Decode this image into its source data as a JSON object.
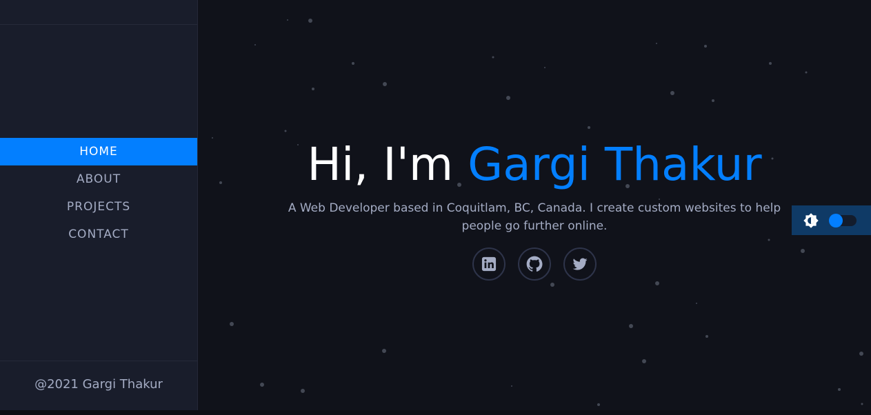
{
  "sidebar": {
    "nav": [
      {
        "label": "HOME",
        "active": true
      },
      {
        "label": "ABOUT",
        "active": false
      },
      {
        "label": "PROJECTS",
        "active": false
      },
      {
        "label": "CONTACT",
        "active": false
      }
    ],
    "footer": "@2021 Gargi Thakur"
  },
  "hero": {
    "greeting": "Hi, I'm ",
    "name": "Gargi Thakur",
    "tagline": "A Web Developer based in Coquitlam, BC, Canada. I create custom websites to help people go further online."
  },
  "socials": [
    {
      "icon": "linkedin-icon"
    },
    {
      "icon": "github-icon"
    },
    {
      "icon": "twitter-icon"
    }
  ],
  "theme_toggle": {
    "icon": "brightness-icon",
    "state": "off"
  },
  "colors": {
    "accent": "#037fff",
    "background": "#10121a",
    "sidebar": "#191d2b",
    "text_muted": "#a4acc4",
    "toggle_bg": "#0f3a66"
  }
}
